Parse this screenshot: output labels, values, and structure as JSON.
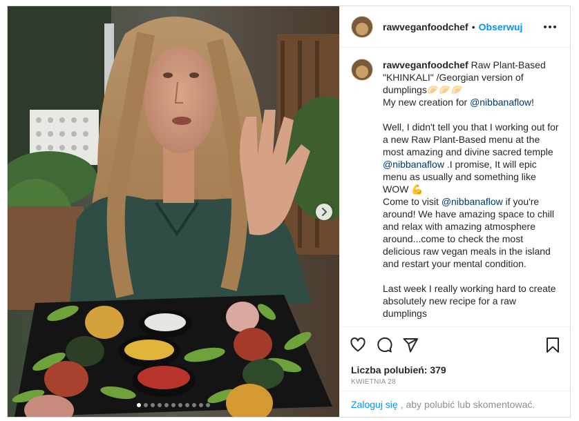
{
  "post": {
    "username": "rawveganfoodchef",
    "separator": "•",
    "follow_label": "Obserwuj",
    "more_icon": "more-horizontal-icon"
  },
  "caption": {
    "username": "rawveganfoodchef",
    "line1": " Raw Plant-Based \"KHINKALI\" /Georgian version of dumplings",
    "emojis1": "🥟🥟🥟",
    "line2_pre": "My new creation for ",
    "mention_nibbana": "@nibbanaflow",
    "line2_post": "!",
    "p2_pre": "Well, I didn't tell you that I working out for a new Raw Plant-Based menu at the most amazing and divine sacred temple ",
    "p2_post": " .I promise, It will epic menu as usually and something like WOW ",
    "emoji_muscle": "💪",
    "p2_line2_pre": "Come to visit ",
    "p2_line2_post": " if you're around! We have amazing space to chill and relax with amazing atmosphere around...come to check the most delicious raw vegan meals in the island and restart your mental condition.",
    "p3": "Last week I really working hard to create absolutely new recipe for a raw dumplings"
  },
  "actions": {
    "like_icon": "heart-icon",
    "comment_icon": "comment-icon",
    "share_icon": "paper-plane-icon",
    "save_icon": "bookmark-icon"
  },
  "likes_label": "Liczba polubień: 379",
  "date_label": "KWIETNIA 28",
  "login": {
    "link": "Zaloguj się",
    "rest": ", aby polubić lub skomentować."
  },
  "carousel": {
    "total": 11,
    "active_index": 0,
    "next_icon": "chevron-right-icon"
  }
}
